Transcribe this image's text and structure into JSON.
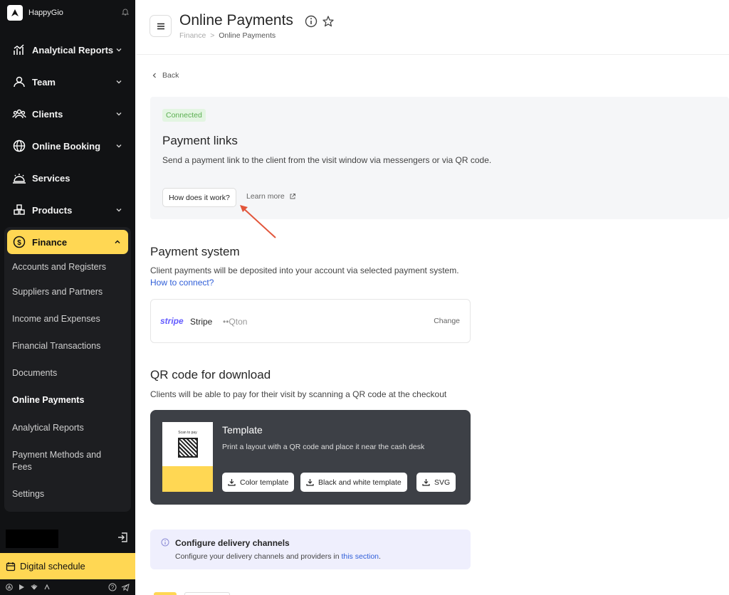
{
  "brand": {
    "name": "HappyGio"
  },
  "sidebar": {
    "items": [
      {
        "label": "Analytical Reports"
      },
      {
        "label": "Team"
      },
      {
        "label": "Clients"
      },
      {
        "label": "Online Booking"
      },
      {
        "label": "Services"
      },
      {
        "label": "Products"
      }
    ],
    "finance": {
      "label": "Finance",
      "sub_items": [
        {
          "label": "Accounts and Registers"
        },
        {
          "label": "Suppliers and Partners"
        },
        {
          "label": "Income and Expenses"
        },
        {
          "label": "Financial Transactions"
        },
        {
          "label": "Documents"
        },
        {
          "label": "Online Payments"
        },
        {
          "label": "Analytical Reports"
        },
        {
          "label": "Payment Methods and Fees"
        },
        {
          "label": "Settings"
        }
      ]
    },
    "digital_schedule": "Digital schedule"
  },
  "header": {
    "title": "Online Payments",
    "breadcrumb_root": "Finance",
    "breadcrumb_sep": ">",
    "breadcrumb_current": "Online Payments"
  },
  "back_label": "Back",
  "payment_links": {
    "badge": "Connected",
    "title": "Payment links",
    "description": "Send a payment link to the client from the visit window via messengers or via QR code.",
    "how_button": "How does it work?",
    "learn_more": "Learn more"
  },
  "payment_system": {
    "title": "Payment system",
    "description": "Client payments will be deposited into your account via selected payment system.",
    "connect_link": "How to connect?",
    "provider_logo": "stripe",
    "provider_name": "Stripe",
    "account": "••Qton",
    "change": "Change"
  },
  "qr": {
    "title": "QR code for download",
    "description": "Clients will be able to pay for their visit by scanning a QR code at the checkout",
    "template_title": "Template",
    "template_desc": "Print a layout with a QR code and place it near the cash desk",
    "thumb_text": "Scan to pay",
    "btn_color": "Color template",
    "btn_bw": "Black and white template",
    "btn_svg": "SVG"
  },
  "delivery": {
    "title": "Configure delivery channels",
    "description": "Configure your delivery channels and providers in",
    "link": "this section",
    "period": "."
  },
  "colors": {
    "accent": "#ffd753",
    "link": "#2f5ed8",
    "success": "#5aae50",
    "arrow": "#e2553a"
  }
}
